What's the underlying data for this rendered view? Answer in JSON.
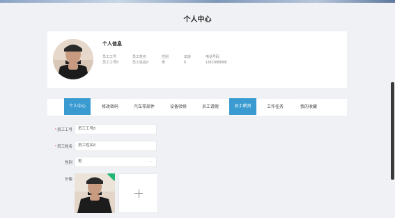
{
  "page": {
    "title": "个人中心"
  },
  "info": {
    "heading": "个人信息",
    "fields": [
      {
        "label": "员工工号",
        "value": "员工工号8"
      },
      {
        "label": "员工姓名",
        "value": "员工姓名8"
      },
      {
        "label": "性别",
        "value": "男"
      },
      {
        "label": "年龄",
        "value": "8"
      },
      {
        "label": "电话号码",
        "value": "13823888888"
      }
    ]
  },
  "tabs": [
    {
      "label": "个人中心",
      "active": true
    },
    {
      "label": "修改密码",
      "active": false
    },
    {
      "label": "汽车零部件",
      "active": false
    },
    {
      "label": "设备验修",
      "active": false
    },
    {
      "label": "员工请假",
      "active": false
    },
    {
      "label": "员工薪资",
      "active": true
    },
    {
      "label": "工作任务",
      "active": false
    },
    {
      "label": "我的收藏",
      "active": false
    }
  ],
  "form": {
    "employee_no": {
      "label": "员工工号",
      "value": "员工工号8",
      "required": "*"
    },
    "employee_name": {
      "label": "员工姓名",
      "value": "员工姓名8",
      "required": "*"
    },
    "gender": {
      "label": "性别",
      "value": "男"
    },
    "avatar": {
      "label": "头像"
    }
  },
  "colors": {
    "accent": "#3a9bd1",
    "badge": "#22b573",
    "required": "#e24b4b"
  }
}
